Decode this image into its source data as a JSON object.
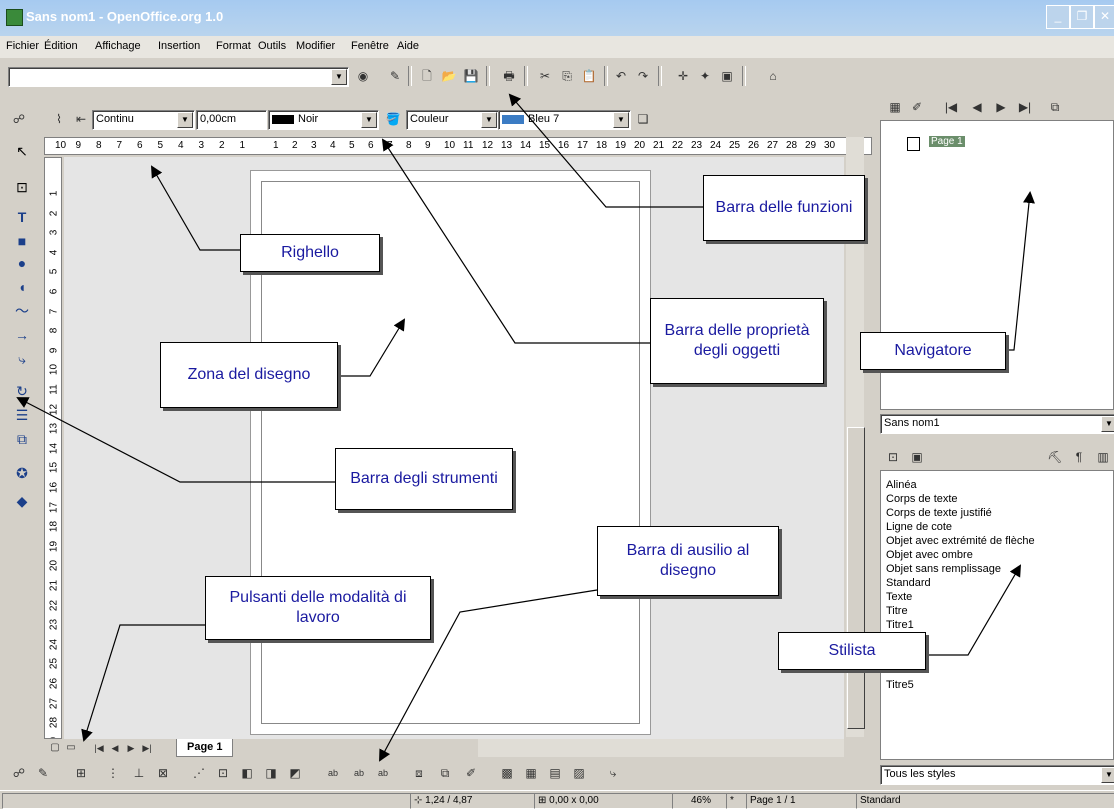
{
  "window": {
    "title": "Sans nom1 - OpenOffice.org 1.0"
  },
  "menu": [
    "Fichier",
    "Édition",
    "Affichage",
    "Insertion",
    "Format",
    "Outils",
    "Modifier",
    "Fenêtre",
    "Aide"
  ],
  "object_bar": {
    "line_style": "Continu",
    "line_width": "0,00cm",
    "line_color": "Noir",
    "fill_type": "Couleur",
    "fill_color": "Bleu 7"
  },
  "hruler_left_ticks": [
    "10",
    "9",
    "8",
    "7",
    "6",
    "5",
    "4",
    "3",
    "2",
    "1"
  ],
  "hruler_right_ticks": [
    "1",
    "2",
    "3",
    "4",
    "5",
    "6",
    "7",
    "8",
    "9",
    "10",
    "11",
    "12",
    "13",
    "14",
    "15",
    "16",
    "17",
    "18",
    "19",
    "20",
    "21",
    "22",
    "23",
    "24",
    "25",
    "26",
    "27",
    "28",
    "29",
    "30"
  ],
  "vruler_ticks": [
    "1",
    "2",
    "3",
    "4",
    "5",
    "6",
    "7",
    "8",
    "9",
    "10",
    "11",
    "12",
    "13",
    "14",
    "15",
    "16",
    "17",
    "18",
    "19",
    "20",
    "21",
    "22",
    "23",
    "24",
    "25",
    "26",
    "27",
    "28",
    "29"
  ],
  "page_tab": "Page 1",
  "navigator": {
    "page_item": "Page 1",
    "document": "Sans nom1"
  },
  "stylist": {
    "items": [
      "Alinéa",
      "Corps de texte",
      "Corps de texte justifié",
      "Ligne de cote",
      "Objet avec extrémité de flèche",
      "Objet avec ombre",
      "Objet sans remplissage",
      "Standard",
      "Texte",
      "Titre",
      "Titre1"
    ],
    "last_item": "Titre5",
    "filter": "Tous les styles"
  },
  "status": {
    "position": "1,24 / 4,87",
    "size": "0,00 x 0,00",
    "zoom": "46%",
    "modified": "*",
    "page": "Page 1 / 1",
    "style": "Standard"
  },
  "callouts": {
    "barra_funzioni": "Barra delle funzioni",
    "righello": "Righello",
    "zona_disegno": "Zona del disegno",
    "barra_proprieta": "Barra delle proprietà degli oggetti",
    "navigatore": "Navigatore",
    "barra_strumenti": "Barra degli strumenti",
    "barra_ausilio": "Barra di ausilio al disegno",
    "pulsanti_modalita": "Pulsanti delle modalità di lavoro",
    "stilista": "Stilista"
  },
  "colors": {
    "title_bar": "#a6caf0",
    "callout_text": "#1a1aa0",
    "navigator_highlight": "#6b8e6b",
    "fill_color_swatch": "#3b7cc4"
  }
}
